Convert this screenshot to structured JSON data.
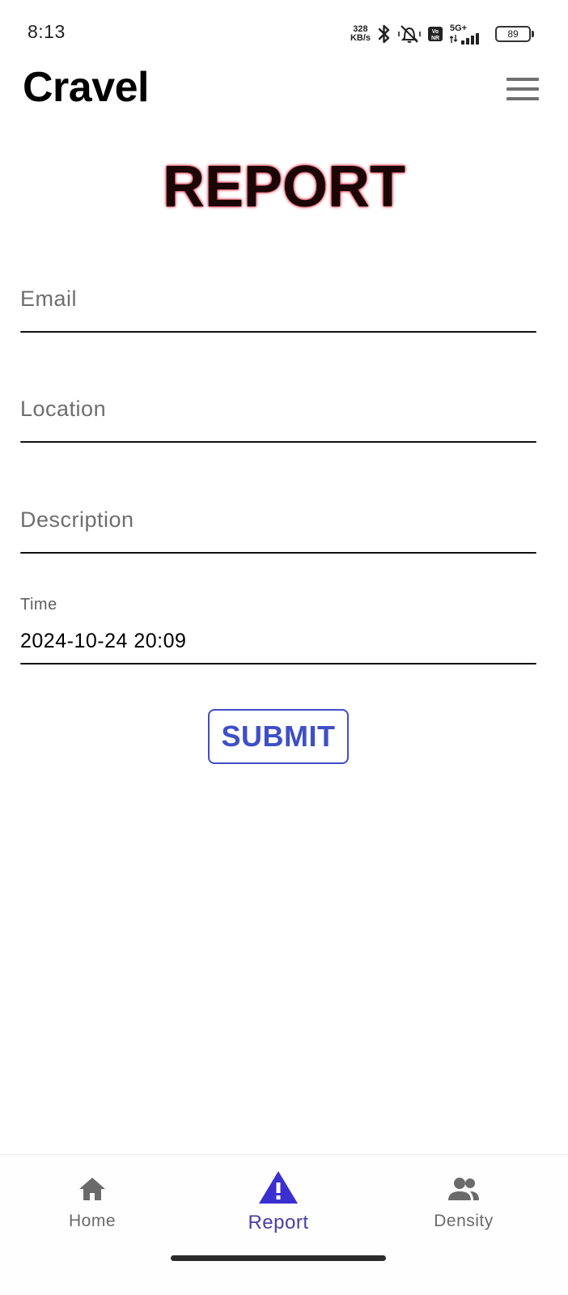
{
  "status_bar": {
    "time": "8:13",
    "net_speed_value": "328",
    "net_speed_unit": "KB/s",
    "network_label": "5G+",
    "battery": "89",
    "icons": [
      "bluetooth-icon",
      "vibrate-mute-icon",
      "volte-icon",
      "signal-icon",
      "battery-icon"
    ]
  },
  "app_bar": {
    "title": "Cravel",
    "menu_icon": "hamburger-menu-icon"
  },
  "page": {
    "heading": "REPORT",
    "heading_color": "#1a0606",
    "heading_glow_color": "#c0102a"
  },
  "form": {
    "email": {
      "placeholder": "Email",
      "value": ""
    },
    "location": {
      "placeholder": "Location",
      "value": ""
    },
    "description": {
      "placeholder": "Description",
      "value": ""
    },
    "time": {
      "label": "Time",
      "value": "2024-10-24 20:09"
    },
    "submit_label": "SUBMIT"
  },
  "colors": {
    "accent": "#3f4fc6",
    "nav_active": "#3a2fd0",
    "nav_inactive": "#6a6a6a"
  },
  "bottom_nav": {
    "items": [
      {
        "label": "Home",
        "icon": "home-icon",
        "active": false
      },
      {
        "label": "Report",
        "icon": "warning-icon",
        "active": true
      },
      {
        "label": "Density",
        "icon": "people-icon",
        "active": false
      }
    ]
  }
}
